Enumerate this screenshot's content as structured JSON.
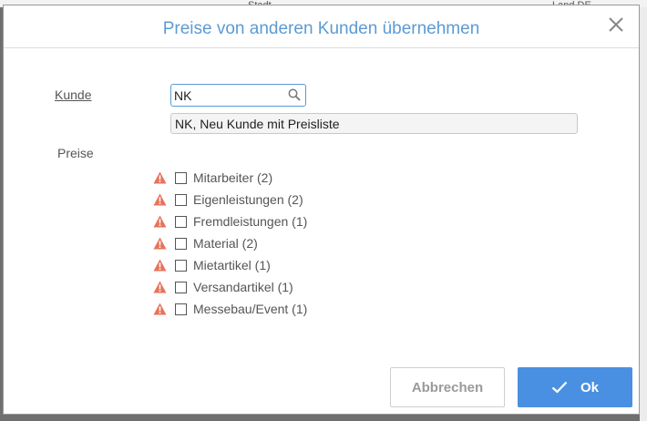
{
  "background": {
    "col1": "Stadt",
    "col2": "Land",
    "col2_value": "DE"
  },
  "dialog": {
    "title": "Preise von anderen Kunden übernehmen",
    "close_icon": "close-icon"
  },
  "kunde": {
    "label": "Kunde",
    "search_value": "NK",
    "search_icon": "search-icon",
    "suggestion": "NK, Neu Kunde mit Preisliste"
  },
  "preise": {
    "label": "Preise",
    "items": [
      {
        "label": "Mitarbeiter (2)",
        "checked": false
      },
      {
        "label": "Eigenleistungen (2)",
        "checked": false
      },
      {
        "label": "Fremdleistungen (1)",
        "checked": false
      },
      {
        "label": "Material (2)",
        "checked": false
      },
      {
        "label": "Mietartikel (1)",
        "checked": false
      },
      {
        "label": "Versandartikel (1)",
        "checked": false
      },
      {
        "label": "Messebau/Event (1)",
        "checked": false
      }
    ]
  },
  "buttons": {
    "cancel_label": "Abbrechen",
    "ok_label": "Ok"
  },
  "colors": {
    "accent": "#5b9bd5",
    "primary_button": "#4a90e2",
    "warning": "#e8735a"
  }
}
